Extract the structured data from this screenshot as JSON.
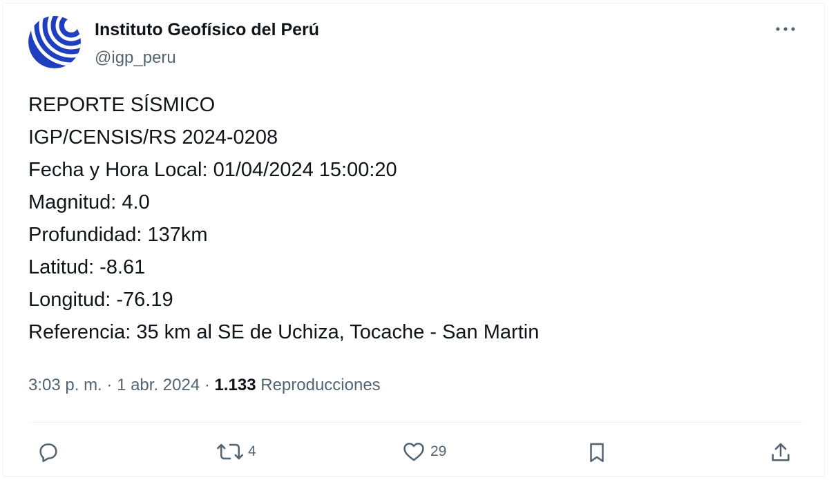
{
  "author": {
    "display_name": "Instituto Geofísico del Perú",
    "handle": "@igp_peru",
    "avatar_icon": "igp-logo-icon"
  },
  "menu": {
    "more_icon": "more-horizontal-icon",
    "more_label": "···"
  },
  "tweet": {
    "lines": [
      "REPORTE SÍSMICO",
      "IGP/CENSIS/RS 2024-0208",
      "Fecha y Hora Local: 01/04/2024 15:00:20",
      "Magnitud: 4.0",
      "Profundidad: 137km",
      "Latitud: -8.61",
      "Longitud: -76.19",
      "Referencia: 35 km al SE de Uchiza, Tocache - San Martin"
    ]
  },
  "meta": {
    "time": "3:03 p. m.",
    "sep1": " · ",
    "date": "1 abr. 2024",
    "sep2": " · ",
    "views_count": "1.133",
    "views_label": " Reproducciones"
  },
  "actions": {
    "reply": {
      "icon": "reply-icon",
      "count": ""
    },
    "retweet": {
      "icon": "retweet-icon",
      "count": "4"
    },
    "like": {
      "icon": "heart-icon",
      "count": "29"
    },
    "bookmark": {
      "icon": "bookmark-icon",
      "count": ""
    },
    "share": {
      "icon": "share-icon",
      "count": ""
    }
  },
  "colors": {
    "text_primary": "#0f1419",
    "text_secondary": "#536471",
    "divider": "#eff3f4",
    "logo_blue": "#1f3fbf"
  }
}
